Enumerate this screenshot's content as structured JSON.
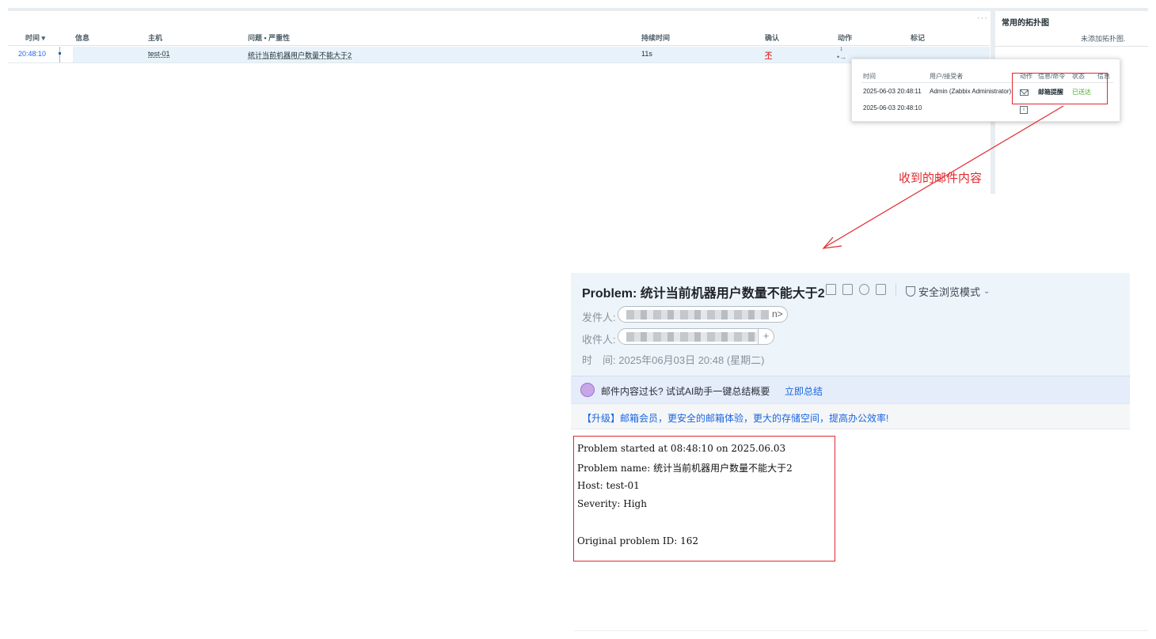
{
  "zabbix": {
    "more_icon": "···",
    "columns": [
      "时间 ▾",
      "信息",
      "主机",
      "问题 • 严重性",
      "持续时间",
      "确认",
      "动作",
      "标记"
    ],
    "row": {
      "time": "20:48:10",
      "host": "test-01",
      "problem": "统计当前机器用户数量不能大于2",
      "duration": "11s",
      "ack": "不",
      "actions_icon": "action-arrow-icon",
      "actions_count": "1"
    },
    "widget": {
      "title": "常用的拓扑图",
      "empty": "未添加拓扑图."
    },
    "popup": {
      "headers": [
        "时间",
        "用户/接受者",
        "动作",
        "信息/命令",
        "状态",
        "信息"
      ],
      "rows": [
        {
          "time": "2025-06-03 20:48:11",
          "user": "Admin (Zabbix Administrator)",
          "action_icon": "mail-icon",
          "message": "邮箱提醒",
          "status": "已送达"
        },
        {
          "time": "2025-06-03 20:48:10",
          "user": "",
          "action_icon": "info-icon",
          "message": "",
          "status": ""
        }
      ]
    }
  },
  "annotation": {
    "label": "收到的邮件内容",
    "color": "#e0282e"
  },
  "email": {
    "subject": "Problem: 统计当前机器用户数量不能大于2",
    "toolbar_icons": [
      "bookmark-icon",
      "flag-icon",
      "clock-icon",
      "print-icon"
    ],
    "safe_mode": "安全浏览模式",
    "sender_label": "发件人:",
    "sender_tail": "n>",
    "recipient_label": "收件人:",
    "recipient_add": "+",
    "date_label": "时　间:",
    "date": "2025年06月03日 20:48 (星期二)",
    "ai_text": "邮件内容过长? 试试AI助手一键总结概要",
    "ai_link": "立即总结",
    "upgrade_text": "【升级】邮箱会员，更安全的邮箱体验，更大的存储空间，提高办公效率!",
    "body": [
      "Problem started at 08:48:10 on 2025.06.03",
      "Problem name: 统计当前机器用户数量不能大于2",
      "Host: test-01",
      "Severity: High",
      "Original problem ID: 162"
    ]
  }
}
